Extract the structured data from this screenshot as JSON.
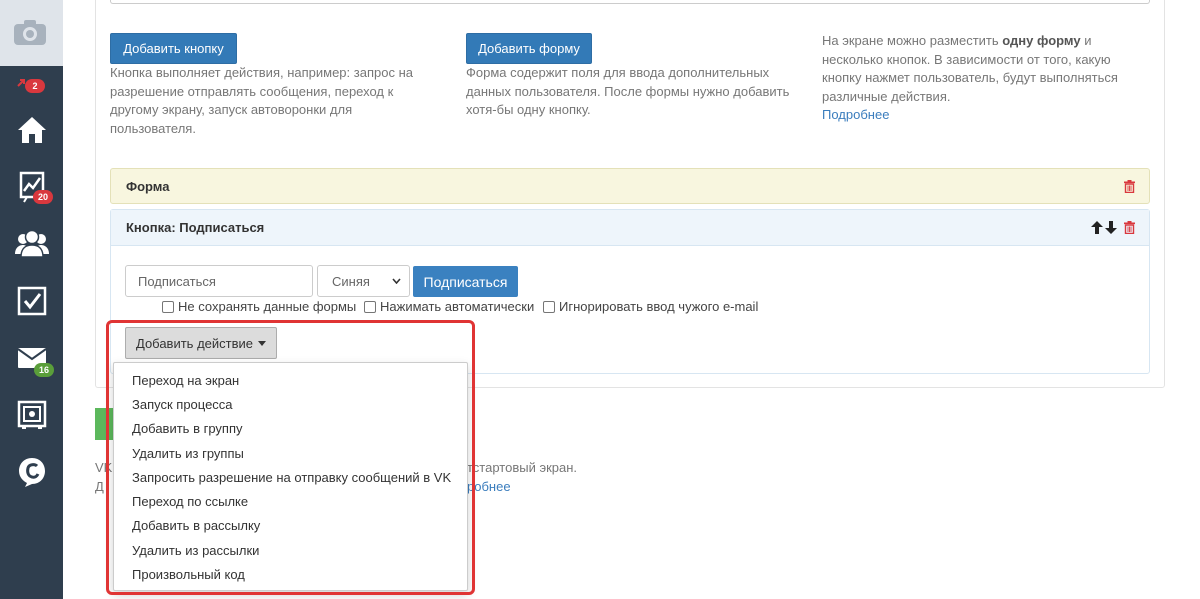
{
  "sidebar": {
    "items": [
      {
        "name": "camera",
        "badge": ""
      },
      {
        "name": "notifications",
        "badge": "2"
      },
      {
        "name": "home",
        "badge": ""
      },
      {
        "name": "stats",
        "badge": "20"
      },
      {
        "name": "users",
        "badge": ""
      },
      {
        "name": "tasks",
        "badge": ""
      },
      {
        "name": "mail",
        "badge": "16"
      },
      {
        "name": "safe",
        "badge": ""
      },
      {
        "name": "logo",
        "badge": ""
      }
    ]
  },
  "toolbar": {
    "add_button_label": "Добавить кнопку",
    "add_button_desc": "Кнопка выполняет действия, например: запрос на разрешение отправлять сообщения, переход к другому экрану, запуск автоворонки для пользователя.",
    "add_form_label": "Добавить форму",
    "add_form_desc": "Форма содержит поля для ввода дополнительных данных пользователя. После формы нужно добавить хотя-бы одну кнопку.",
    "info_part1": "На экране можно разместить ",
    "info_bold": "одну форму",
    "info_part2": " и несколько кнопок. В зависимости от того, какую кнопку нажмет пользователь, будут выполняться различные действия.",
    "info_link": "Подробнее"
  },
  "form_panel": {
    "title": "Форма"
  },
  "button_panel": {
    "title": "Кнопка: Подписаться",
    "text_input_value": "Подписаться",
    "color_select_value": "Синяя",
    "preview_button_label": "Подписаться",
    "checkboxes": [
      {
        "label": "Не сохранять данные формы",
        "checked": false
      },
      {
        "label": "Нажимать автоматически",
        "checked": false
      },
      {
        "label": "Игнорировать ввод чужого e-mail",
        "checked": false
      }
    ],
    "add_action_label": "Добавить действие"
  },
  "action_menu": {
    "items": [
      "Переход на экран",
      "Запуск процесса",
      "Добавить в группу",
      "Удалить из группы",
      "Запросить разрешение на отправку сообщений в VK",
      "Переход по ссылке",
      "Добавить в рассылку",
      "Удалить из рассылки",
      "Произвольный код"
    ]
  },
  "below": {
    "line1_start": "VK",
    "line1_end": "тстартовый экран.",
    "line2_start": "Д",
    "line2_link": "робнее"
  },
  "colors": {
    "sidebar_bg": "#2f3e4e",
    "primary_button": "#337ab7",
    "form_panel_bg": "#f8f6df",
    "button_panel_bg": "#eef5fb",
    "highlight_border": "#e03434",
    "save_button_green": "#5cb85c"
  }
}
